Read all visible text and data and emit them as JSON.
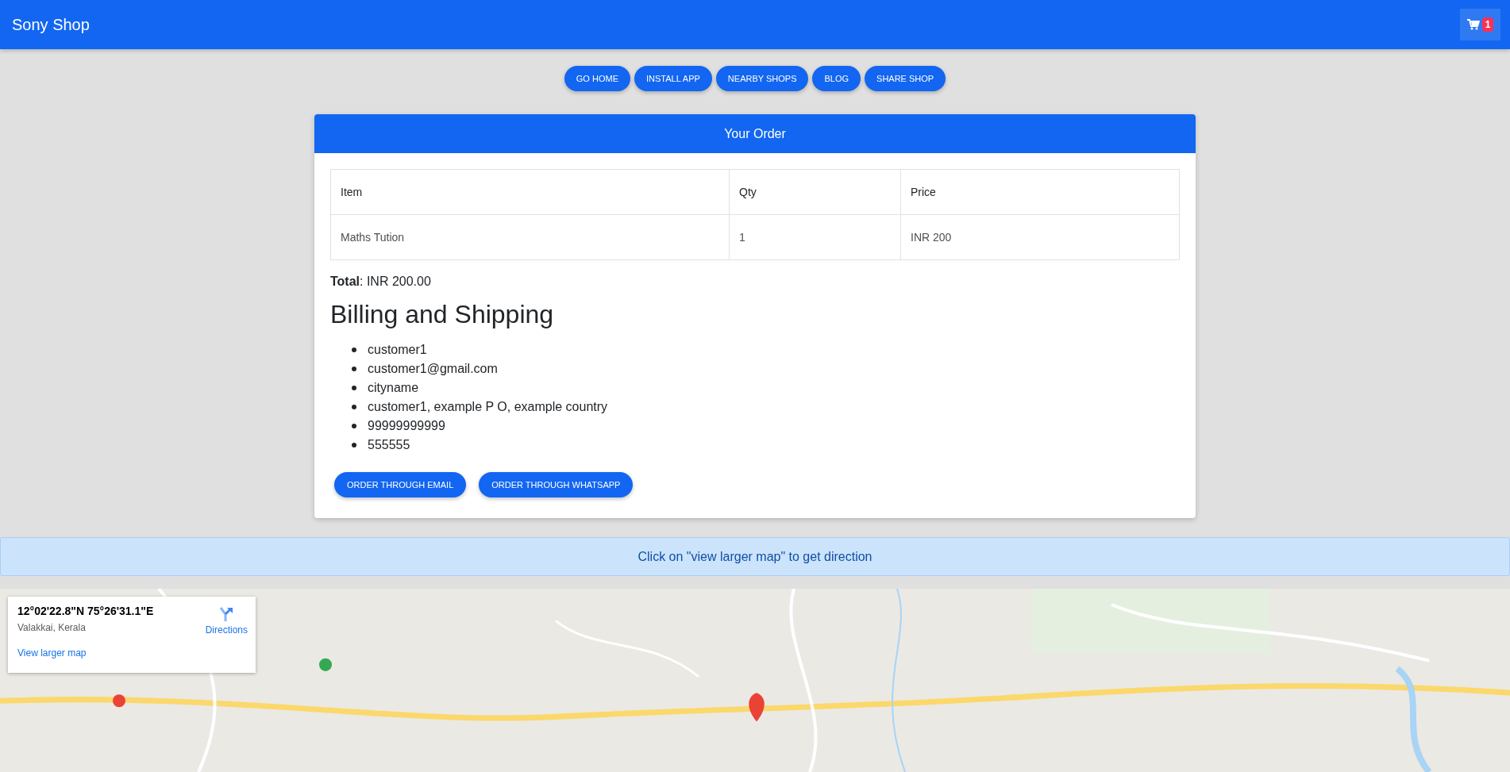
{
  "navbar": {
    "brand": "Sony Shop",
    "cart_count": "1"
  },
  "nav_buttons": [
    "GO HOME",
    "INSTALL APP",
    "NEARBY SHOPS",
    "BLOG",
    "SHARE SHOP"
  ],
  "order": {
    "title": "Your Order",
    "table": {
      "columns": [
        "Item",
        "Qty",
        "Price"
      ],
      "rows": [
        [
          "Maths Tution",
          "1",
          "INR 200"
        ]
      ]
    },
    "total": "**Total**: INR 200.00",
    "billing_title": "Billing and Shipping",
    "billing": [
      "customer1",
      "customer1@gmail.com",
      "cityname",
      "customer1, example P O, example country",
      "99999999999",
      "555555"
    ],
    "buttons": [
      "ORDER THROUGH EMAIL",
      "ORDER THROUGH WHATSAPP"
    ]
  },
  "alert": "Click on \"view larger map\" to get direction",
  "map": {
    "kind": "picture",
    "info": {
      "coords": "12°02'22.8\"N 75°26'31.1\"E",
      "place": "Valakkai, Kerala",
      "directions": "Directions",
      "larger_map": "View larger map"
    }
  }
}
